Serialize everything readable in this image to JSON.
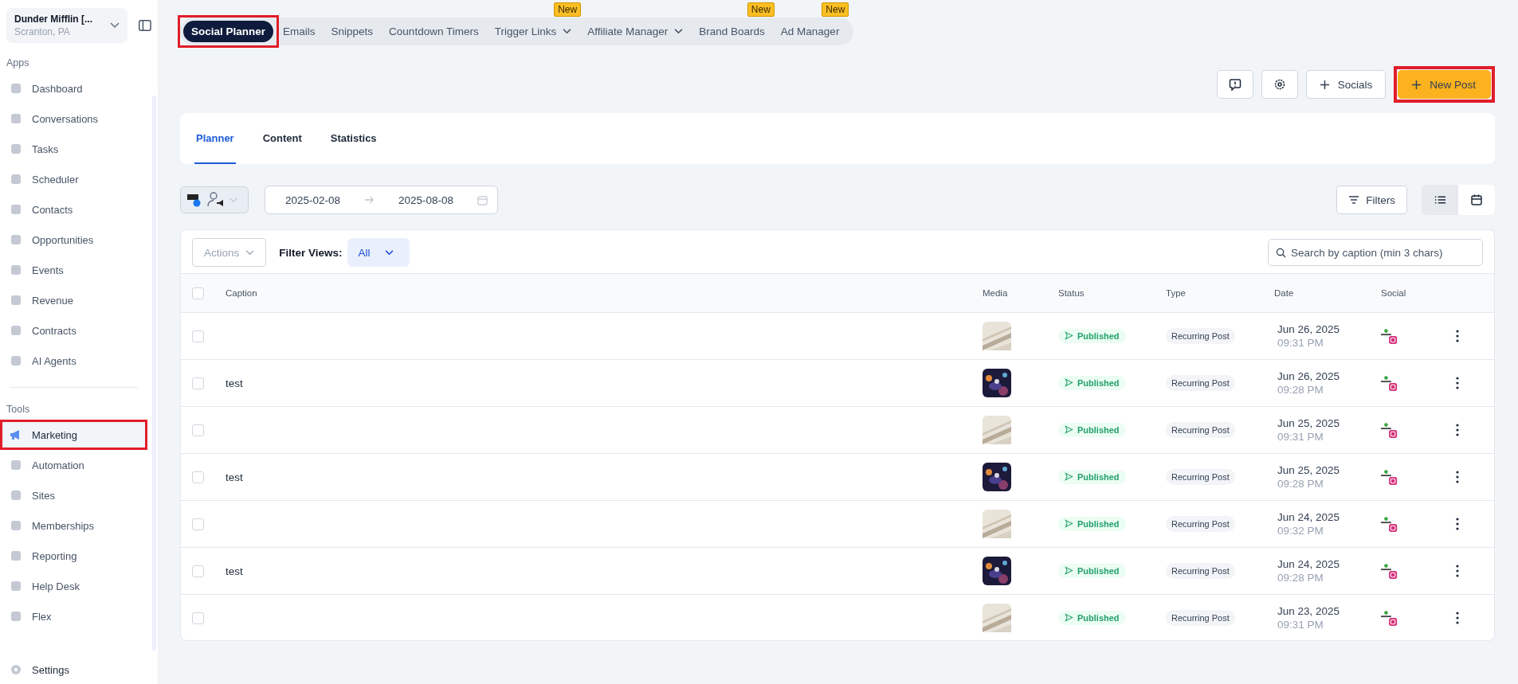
{
  "account": {
    "name": "Dunder Mifflin [...",
    "location": "Scranton, PA"
  },
  "sidebar": {
    "sections": [
      {
        "title": "Apps",
        "items": [
          {
            "label": "Dashboard",
            "selected": false,
            "highlighted": false
          },
          {
            "label": "Conversations",
            "selected": false,
            "highlighted": false
          },
          {
            "label": "Tasks",
            "selected": false,
            "highlighted": false
          },
          {
            "label": "Scheduler",
            "selected": false,
            "highlighted": false
          },
          {
            "label": "Contacts",
            "selected": false,
            "highlighted": false
          },
          {
            "label": "Opportunities",
            "selected": false,
            "highlighted": false
          },
          {
            "label": "Events",
            "selected": false,
            "highlighted": false
          },
          {
            "label": "Revenue",
            "selected": false,
            "highlighted": false
          },
          {
            "label": "Contracts",
            "selected": false,
            "highlighted": false
          },
          {
            "label": "AI Agents",
            "selected": false,
            "highlighted": false
          }
        ]
      },
      {
        "title": "Tools",
        "items": [
          {
            "label": "Marketing",
            "selected": true,
            "highlighted": true
          },
          {
            "label": "Automation",
            "selected": false,
            "highlighted": false
          },
          {
            "label": "Sites",
            "selected": false,
            "highlighted": false
          },
          {
            "label": "Memberships",
            "selected": false,
            "highlighted": false
          },
          {
            "label": "Reporting",
            "selected": false,
            "highlighted": false
          },
          {
            "label": "Help Desk",
            "selected": false,
            "highlighted": false
          },
          {
            "label": "Flex",
            "selected": false,
            "highlighted": false
          }
        ]
      }
    ],
    "footer": "Settings"
  },
  "top_tabs": [
    {
      "label": "Social Planner",
      "selected": true,
      "highlighted": true,
      "dropdown": false
    },
    {
      "label": "Emails",
      "selected": false,
      "highlighted": false,
      "dropdown": false
    },
    {
      "label": "Snippets",
      "selected": false,
      "highlighted": false,
      "dropdown": false
    },
    {
      "label": "Countdown Timers",
      "selected": false,
      "highlighted": false,
      "dropdown": false
    },
    {
      "label": "Trigger Links",
      "selected": false,
      "highlighted": false,
      "dropdown": true,
      "badge": "New"
    },
    {
      "label": "Affiliate Manager",
      "selected": false,
      "highlighted": false,
      "dropdown": true
    },
    {
      "label": "Brand Boards",
      "selected": false,
      "highlighted": false,
      "dropdown": false,
      "badge": "New"
    },
    {
      "label": "Ad Manager",
      "selected": false,
      "highlighted": false,
      "dropdown": false,
      "badge": "New"
    }
  ],
  "actions": {
    "socials": "Socials",
    "new_post": "New Post",
    "new_post_highlighted": true
  },
  "view_tabs": [
    {
      "label": "Planner",
      "selected": true
    },
    {
      "label": "Content",
      "selected": false
    },
    {
      "label": "Statistics",
      "selected": false
    }
  ],
  "date_range": {
    "start": "2025-02-08",
    "end": "2025-08-08"
  },
  "filters_button": "Filters",
  "view_toggle": [
    {
      "kind": "list",
      "selected": true
    },
    {
      "kind": "calendar",
      "selected": false
    }
  ],
  "table_toolbar": {
    "actions": "Actions",
    "filter_label": "Filter Views:",
    "filter_value": "All",
    "search_placeholder": "Search by caption (min 3 chars)"
  },
  "table": {
    "select_all_checked": false,
    "columns": [
      "Caption",
      "Media",
      "Status",
      "Type",
      "Date",
      "Social"
    ],
    "rows": [
      {
        "checked": false,
        "caption": "",
        "status": "Published",
        "type": "Recurring Post",
        "date": "Jun 26, 2025",
        "time": "09:31 PM"
      },
      {
        "checked": false,
        "caption": "test",
        "status": "Published",
        "type": "Recurring Post",
        "date": "Jun 26, 2025",
        "time": "09:28 PM"
      },
      {
        "checked": false,
        "caption": "",
        "status": "Published",
        "type": "Recurring Post",
        "date": "Jun 25, 2025",
        "time": "09:31 PM"
      },
      {
        "checked": false,
        "caption": "test",
        "status": "Published",
        "type": "Recurring Post",
        "date": "Jun 25, 2025",
        "time": "09:28 PM"
      },
      {
        "checked": false,
        "caption": "",
        "status": "Published",
        "type": "Recurring Post",
        "date": "Jun 24, 2025",
        "time": "09:32 PM"
      },
      {
        "checked": false,
        "caption": "test",
        "status": "Published",
        "type": "Recurring Post",
        "date": "Jun 24, 2025",
        "time": "09:28 PM"
      },
      {
        "checked": false,
        "caption": "",
        "status": "Published",
        "type": "Recurring Post",
        "date": "Jun 23, 2025",
        "time": "09:31 PM"
      }
    ]
  }
}
